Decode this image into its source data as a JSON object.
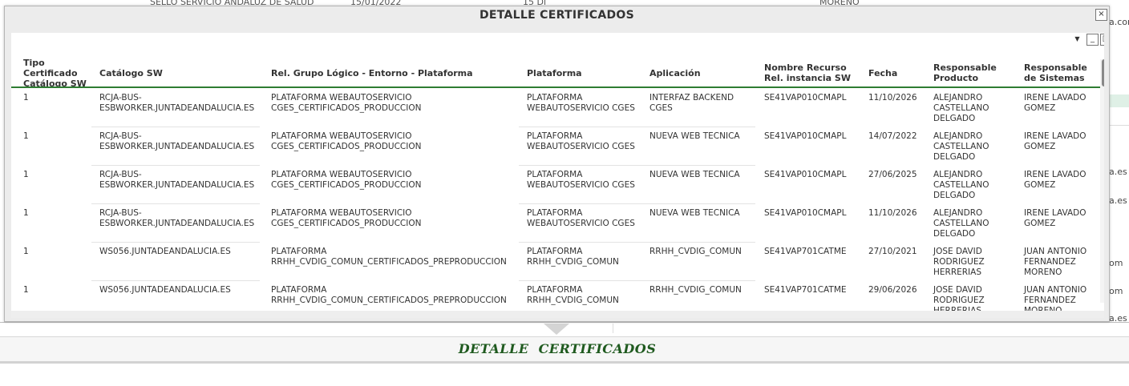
{
  "background": {
    "top_fragments": [
      "SELLO SERVICIO ANDALUZ DE SALUD",
      "15/01/2022",
      "15 Dí",
      "MORENO"
    ],
    "right_fragments": [
      "a.com",
      "a.es",
      "a.es",
      "om",
      "om",
      "a.es"
    ],
    "section_title": "DETALLE  CERTIFICADOS"
  },
  "modal": {
    "title": "DETALLE CERTIFICADOS",
    "close_symbol": "×",
    "collapse_symbol": "▼",
    "minimize_symbol": "_",
    "maximize_symbol": "□"
  },
  "table": {
    "headers": {
      "tipo": "Tipo Certificado Catálogo SW",
      "catalogo": "Catálogo SW",
      "rel_grupo": "Rel. Grupo Lógico - Entorno - Plataforma",
      "plataforma": "Plataforma",
      "aplicacion": "Aplicación",
      "recurso": "Nombre Recurso Rel. instancia SW",
      "fecha": "Fecha",
      "resp_producto": "Responsable Producto",
      "resp_sistemas": "Responsable de Sistemas"
    },
    "rows": [
      {
        "tipo": "1",
        "catalogo": "RCJA-BUS-\nESBWORKER.JUNTADEANDALUCIA.ES",
        "rel_grupo": "PLATAFORMA WEBAUTOSERVICIO\nCGES_CERTIFICADOS_PRODUCCION",
        "plataforma": "PLATAFORMA\nWEBAUTOSERVICIO CGES",
        "aplicacion": "INTERFAZ BACKEND\nCGES",
        "recurso": "SE41VAP010CMAPL",
        "fecha": "11/10/2026",
        "resp_producto": "ALEJANDRO\nCASTELLANO\nDELGADO",
        "resp_sistemas": "IRENE LAVADO\nGOMEZ"
      },
      {
        "tipo": "1",
        "catalogo": "RCJA-BUS-\nESBWORKER.JUNTADEANDALUCIA.ES",
        "rel_grupo": "PLATAFORMA WEBAUTOSERVICIO\nCGES_CERTIFICADOS_PRODUCCION",
        "plataforma": "PLATAFORMA\nWEBAUTOSERVICIO CGES",
        "aplicacion": "NUEVA WEB TECNICA",
        "recurso": "SE41VAP010CMAPL",
        "fecha": "14/07/2022",
        "resp_producto": "ALEJANDRO\nCASTELLANO\nDELGADO",
        "resp_sistemas": "IRENE LAVADO\nGOMEZ"
      },
      {
        "tipo": "1",
        "catalogo": "RCJA-BUS-\nESBWORKER.JUNTADEANDALUCIA.ES",
        "rel_grupo": "PLATAFORMA WEBAUTOSERVICIO\nCGES_CERTIFICADOS_PRODUCCION",
        "plataforma": "PLATAFORMA\nWEBAUTOSERVICIO CGES",
        "aplicacion": "NUEVA WEB TECNICA",
        "recurso": "SE41VAP010CMAPL",
        "fecha": "27/06/2025",
        "resp_producto": "ALEJANDRO\nCASTELLANO\nDELGADO",
        "resp_sistemas": "IRENE LAVADO\nGOMEZ"
      },
      {
        "tipo": "1",
        "catalogo": "RCJA-BUS-\nESBWORKER.JUNTADEANDALUCIA.ES",
        "rel_grupo": "PLATAFORMA WEBAUTOSERVICIO\nCGES_CERTIFICADOS_PRODUCCION",
        "plataforma": "PLATAFORMA\nWEBAUTOSERVICIO CGES",
        "aplicacion": "NUEVA WEB TECNICA",
        "recurso": "SE41VAP010CMAPL",
        "fecha": "11/10/2026",
        "resp_producto": "ALEJANDRO\nCASTELLANO\nDELGADO",
        "resp_sistemas": "IRENE LAVADO\nGOMEZ"
      },
      {
        "tipo": "1",
        "catalogo": "WS056.JUNTADEANDALUCIA.ES",
        "rel_grupo": "PLATAFORMA\nRRHH_CVDIG_COMUN_CERTIFICADOS_PREPRODUCCION",
        "plataforma": "PLATAFORMA\nRRHH_CVDIG_COMUN",
        "aplicacion": "RRHH_CVDIG_COMUN",
        "recurso": "SE41VAP701CATME",
        "fecha": "27/10/2021",
        "resp_producto": "JOSE DAVID\nRODRIGUEZ\nHERRERIAS",
        "resp_sistemas": "JUAN ANTONIO\nFERNANDEZ\nMORENO"
      },
      {
        "tipo": "1",
        "catalogo": "WS056.JUNTADEANDALUCIA.ES",
        "rel_grupo": "PLATAFORMA\nRRHH_CVDIG_COMUN_CERTIFICADOS_PREPRODUCCION",
        "plataforma": "PLATAFORMA\nRRHH_CVDIG_COMUN",
        "aplicacion": "RRHH_CVDIG_COMUN",
        "recurso": "SE41VAP701CATME",
        "fecha": "29/06/2026",
        "resp_producto": "JOSE DAVID\nRODRIGUEZ\nHERRERIAS",
        "resp_sistemas": "JUAN ANTONIO\nFERNANDEZ\nMORENO"
      }
    ]
  }
}
